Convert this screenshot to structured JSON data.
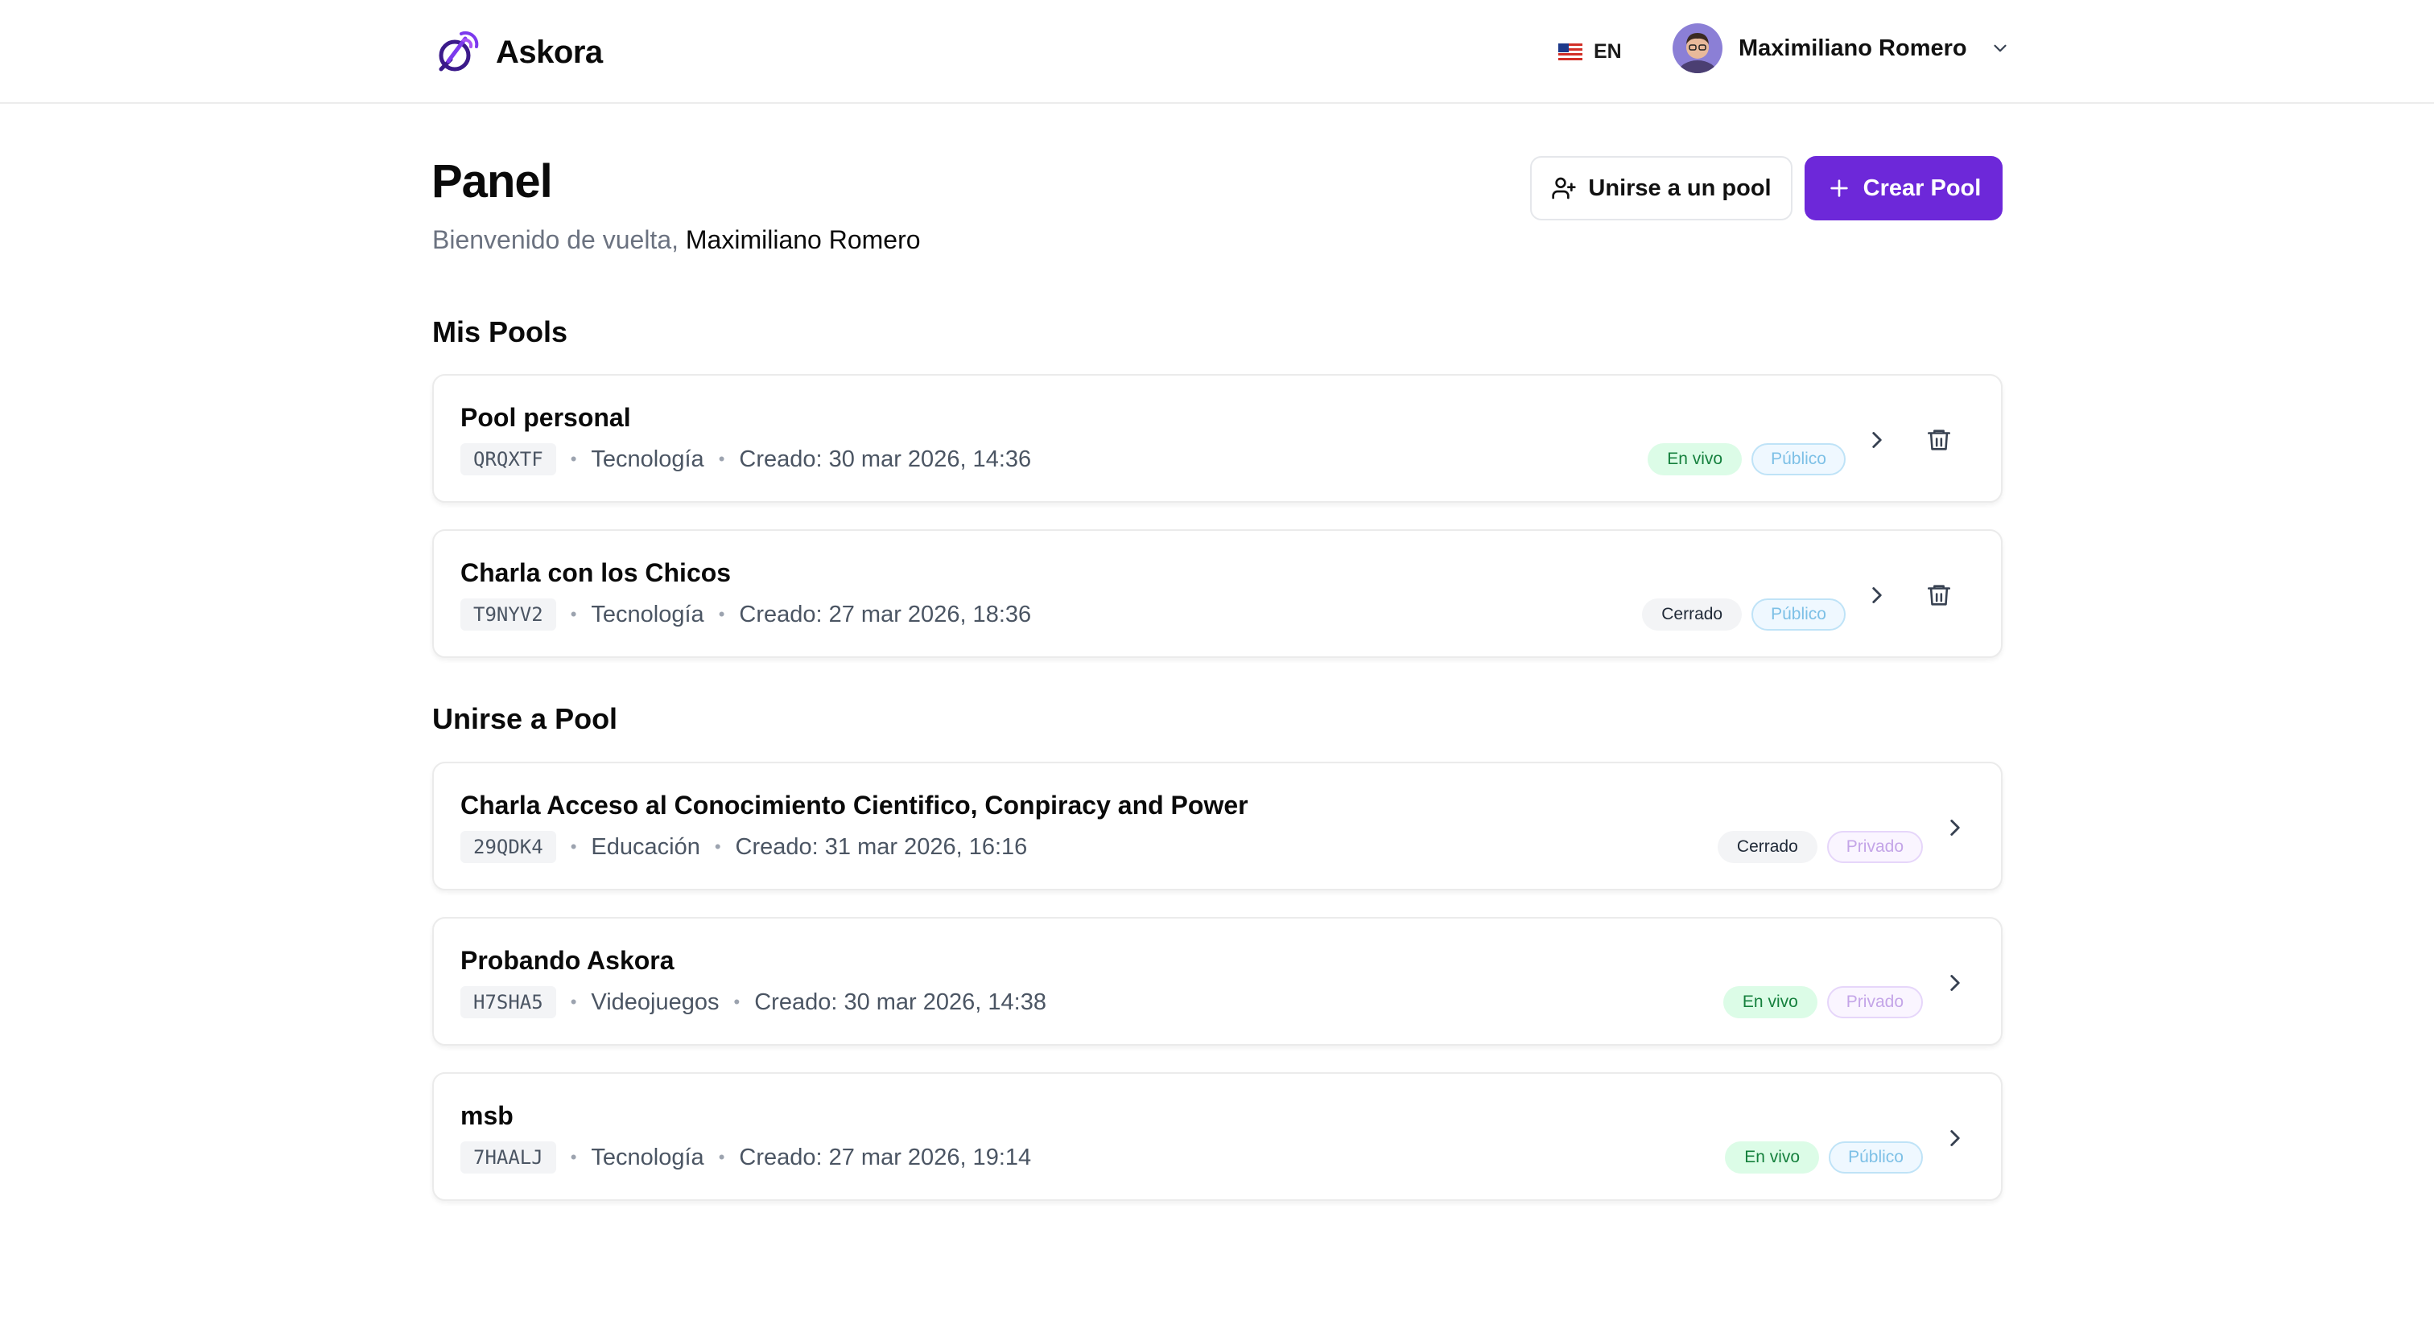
{
  "app": {
    "name": "Askora"
  },
  "header": {
    "language": "EN",
    "user_name": "Maximiliano Romero"
  },
  "page": {
    "title": "Panel",
    "welcome_prefix": "Bienvenido de vuelta,",
    "welcome_name": "Maximiliano Romero",
    "join_button": "Unirse a un pool",
    "create_button": "Crear Pool"
  },
  "my_pools": {
    "title": "Mis Pools",
    "items": [
      {
        "name": "Pool personal",
        "code": "QRQXTF",
        "category": "Tecnología",
        "created": "Creado: 30 mar 2026, 14:36",
        "status": "En vivo",
        "visibility": "Público"
      },
      {
        "name": "Charla con los Chicos",
        "code": "T9NYV2",
        "category": "Tecnología",
        "created": "Creado: 27 mar 2026, 18:36",
        "status": "Cerrado",
        "visibility": "Público"
      }
    ]
  },
  "join_pools": {
    "title": "Unirse a Pool",
    "items": [
      {
        "name": "Charla Acceso al Conocimiento Cientifico, Conpiracy and Power",
        "code": "29QDK4",
        "category": "Educación",
        "created": "Creado: 31 mar 2026, 16:16",
        "status": "Cerrado",
        "visibility": "Privado"
      },
      {
        "name": "Probando Askora",
        "code": "H7SHA5",
        "category": "Videojuegos",
        "created": "Creado: 30 mar 2026, 14:38",
        "status": "En vivo",
        "visibility": "Privado"
      },
      {
        "name": "msb",
        "code": "7HAALJ",
        "category": "Tecnología",
        "created": "Creado: 27 mar 2026, 19:14",
        "status": "En vivo",
        "visibility": "Público"
      }
    ]
  },
  "colors": {
    "accent": "#6d28d9",
    "live_bg": "#dcfce7",
    "live_text": "#15803d",
    "public_text": "#7dc0e6",
    "private_text": "#c4a5e8"
  }
}
